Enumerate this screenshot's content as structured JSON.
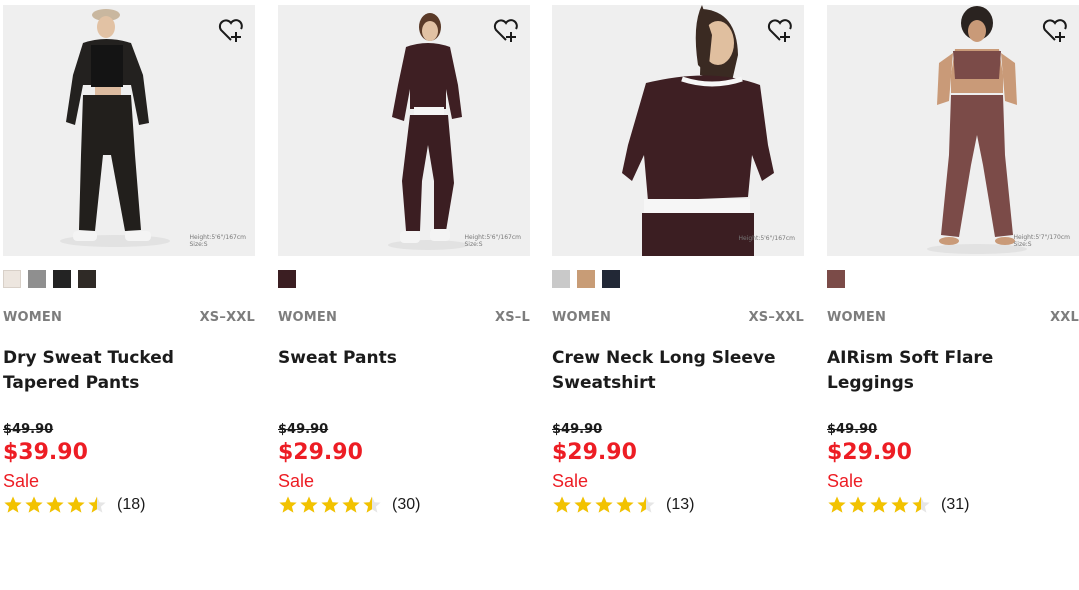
{
  "products": [
    {
      "favorite_icon": "heart-plus-icon",
      "caption": [
        "Height:5'6\"/167cm",
        "Size:S"
      ],
      "colors": [
        "#ede6df",
        "#8f8f8f",
        "#232323",
        "#2f2a26"
      ],
      "gender": "WOMEN",
      "sizes": "XS–XXL",
      "name": "Dry Sweat Tucked Tapered Pants",
      "original_price": "$49.90",
      "sale_price": "$39.90",
      "flag": "Sale",
      "rating": 4.5,
      "review_count": "(18)"
    },
    {
      "favorite_icon": "heart-plus-icon",
      "caption": [
        "Height:5'6\"/167cm",
        "Size:S"
      ],
      "colors": [
        "#3b1e22"
      ],
      "gender": "WOMEN",
      "sizes": "XS–L",
      "name": "Sweat Pants",
      "original_price": "$49.90",
      "sale_price": "$29.90",
      "flag": "Sale",
      "rating": 4.5,
      "review_count": "(30)"
    },
    {
      "favorite_icon": "heart-plus-icon",
      "caption": [
        "Height:5'6\"/167cm"
      ],
      "colors": [
        "#c9c9c9",
        "#c89c76",
        "#222836"
      ],
      "gender": "WOMEN",
      "sizes": "XS–XXL",
      "name": "Crew Neck Long Sleeve Sweatshirt",
      "original_price": "$49.90",
      "sale_price": "$29.90",
      "flag": "Sale",
      "rating": 4.5,
      "review_count": "(13)"
    },
    {
      "favorite_icon": "heart-plus-icon",
      "caption": [
        "Height:5'7\"/170cm",
        "Size:S"
      ],
      "colors": [
        "#7b4b48"
      ],
      "gender": "WOMEN",
      "sizes": "XXL",
      "name": "AIRism Soft Flare Leggings",
      "original_price": "$49.90",
      "sale_price": "$29.90",
      "flag": "Sale",
      "rating": 4.5,
      "review_count": "(31)"
    }
  ],
  "colors": {
    "sale_red": "#ed1d24",
    "star_gold": "#f2c200",
    "muted_text": "#7d7d7d"
  }
}
